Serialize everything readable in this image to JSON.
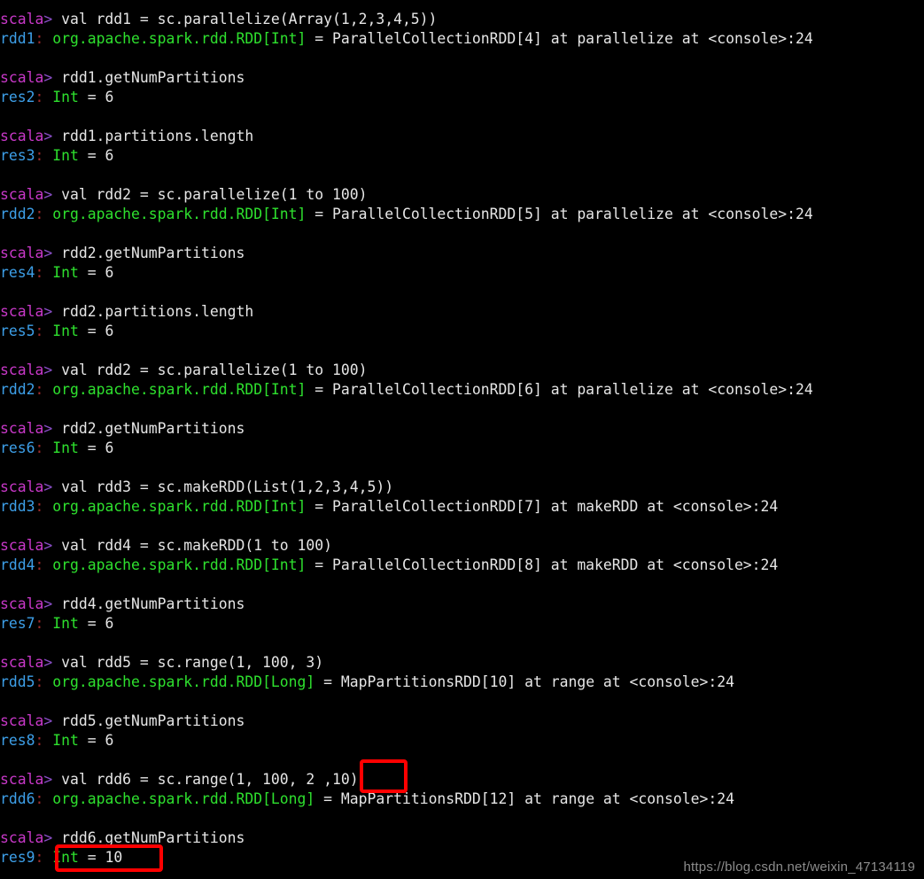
{
  "terminal": {
    "app": "Spark Scala REPL (spark-shell)",
    "prompt": "scala",
    "prompt_arrow": ">",
    "background_color": "#000000",
    "colors": {
      "prompt": "#c838c8",
      "identifier": "#3d9fe8",
      "type": "#2ee02e",
      "text": "#e6e6e6",
      "colon": "#9e2b2b",
      "highlight_box": "#ff0000",
      "watermark": "#8c8c8c"
    },
    "lines": [
      {
        "kind": "input",
        "cmd": " val rdd1 = sc.parallelize(Array(1,2,3,4,5))"
      },
      {
        "kind": "output",
        "name": "rdd1",
        "type": "org.apache.spark.rdd.RDD[Int]",
        "value": " = ParallelCollectionRDD[4] at parallelize at <console>:24"
      },
      {
        "kind": "blank"
      },
      {
        "kind": "input",
        "cmd": " rdd1.getNumPartitions"
      },
      {
        "kind": "output",
        "name": "res2",
        "type": "Int",
        "value": " = 6"
      },
      {
        "kind": "blank"
      },
      {
        "kind": "input",
        "cmd": " rdd1.partitions.length"
      },
      {
        "kind": "output",
        "name": "res3",
        "type": "Int",
        "value": " = 6"
      },
      {
        "kind": "blank"
      },
      {
        "kind": "input",
        "cmd": " val rdd2 = sc.parallelize(1 to 100)"
      },
      {
        "kind": "output",
        "name": "rdd2",
        "type": "org.apache.spark.rdd.RDD[Int]",
        "value": " = ParallelCollectionRDD[5] at parallelize at <console>:24"
      },
      {
        "kind": "blank"
      },
      {
        "kind": "input",
        "cmd": " rdd2.getNumPartitions"
      },
      {
        "kind": "output",
        "name": "res4",
        "type": "Int",
        "value": " = 6"
      },
      {
        "kind": "blank"
      },
      {
        "kind": "input",
        "cmd": " rdd2.partitions.length"
      },
      {
        "kind": "output",
        "name": "res5",
        "type": "Int",
        "value": " = 6"
      },
      {
        "kind": "blank"
      },
      {
        "kind": "input",
        "cmd": " val rdd2 = sc.parallelize(1 to 100)"
      },
      {
        "kind": "output",
        "name": "rdd2",
        "type": "org.apache.spark.rdd.RDD[Int]",
        "value": " = ParallelCollectionRDD[6] at parallelize at <console>:24"
      },
      {
        "kind": "blank"
      },
      {
        "kind": "input",
        "cmd": " rdd2.getNumPartitions"
      },
      {
        "kind": "output",
        "name": "res6",
        "type": "Int",
        "value": " = 6"
      },
      {
        "kind": "blank"
      },
      {
        "kind": "input",
        "cmd": " val rdd3 = sc.makeRDD(List(1,2,3,4,5))"
      },
      {
        "kind": "output",
        "name": "rdd3",
        "type": "org.apache.spark.rdd.RDD[Int]",
        "value": " = ParallelCollectionRDD[7] at makeRDD at <console>:24"
      },
      {
        "kind": "blank"
      },
      {
        "kind": "input",
        "cmd": " val rdd4 = sc.makeRDD(1 to 100)"
      },
      {
        "kind": "output",
        "name": "rdd4",
        "type": "org.apache.spark.rdd.RDD[Int]",
        "value": " = ParallelCollectionRDD[8] at makeRDD at <console>:24"
      },
      {
        "kind": "blank"
      },
      {
        "kind": "input",
        "cmd": " rdd4.getNumPartitions"
      },
      {
        "kind": "output",
        "name": "res7",
        "type": "Int",
        "value": " = 6"
      },
      {
        "kind": "blank"
      },
      {
        "kind": "input",
        "cmd": " val rdd5 = sc.range(1, 100, 3)"
      },
      {
        "kind": "output",
        "name": "rdd5",
        "type": "org.apache.spark.rdd.RDD[Long]",
        "value": " = MapPartitionsRDD[10] at range at <console>:24"
      },
      {
        "kind": "blank"
      },
      {
        "kind": "input",
        "cmd": " rdd5.getNumPartitions"
      },
      {
        "kind": "output",
        "name": "res8",
        "type": "Int",
        "value": " = 6"
      },
      {
        "kind": "blank"
      },
      {
        "kind": "input",
        "cmd": " val rdd6 = sc.range(1, 100, 2 ,10)"
      },
      {
        "kind": "output",
        "name": "rdd6",
        "type": "org.apache.spark.rdd.RDD[Long]",
        "value": " = MapPartitionsRDD[12] at range at <console>:24"
      },
      {
        "kind": "blank"
      },
      {
        "kind": "input",
        "cmd": " rdd6.getNumPartitions"
      },
      {
        "kind": "output",
        "name": "res9",
        "type": "Int",
        "value": " = 10"
      }
    ]
  },
  "annotations": {
    "highlight_partitions_arg": ",10)",
    "highlight_result": "Int = 10"
  },
  "watermark": {
    "text": "https://blog.csdn.net/weixin_47134119"
  }
}
